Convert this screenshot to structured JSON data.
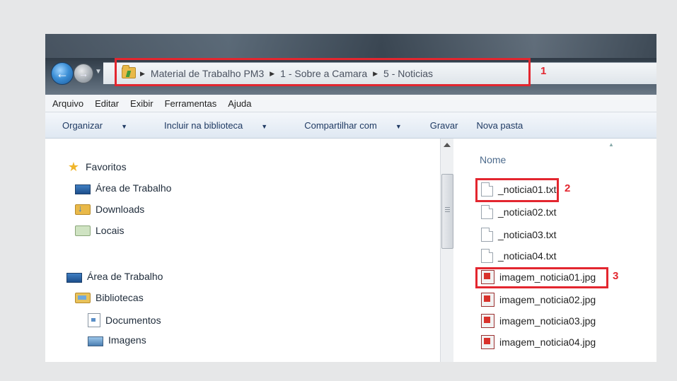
{
  "address_bar": {
    "crumbs": [
      "Material de Trabalho PM3",
      "1 - Sobre a Camara",
      "5 - Noticias"
    ],
    "marker": "1"
  },
  "menu": [
    "Arquivo",
    "Editar",
    "Exibir",
    "Ferramentas",
    "Ajuda"
  ],
  "toolbar": {
    "organize": "Organizar",
    "include_library": "Incluir na biblioteca",
    "share": "Compartilhar com",
    "burn": "Gravar",
    "new_folder": "Nova pasta"
  },
  "nav": {
    "favorites": "Favoritos",
    "fav_desktop": "Área de Trabalho",
    "downloads": "Downloads",
    "locais": "Locais",
    "desktop": "Área de Trabalho",
    "libraries": "Bibliotecas",
    "documents": "Documentos",
    "images": "Imagens"
  },
  "file_list": {
    "column_name": "Nome",
    "files": [
      "_noticia01.txt",
      "_noticia02.txt",
      "_noticia03.txt",
      "_noticia04.txt",
      "imagem_noticia01.jpg",
      "imagem_noticia02.jpg",
      "imagem_noticia03.jpg",
      "imagem_noticia04.jpg"
    ],
    "marker_txt": "2",
    "marker_jpg": "3"
  },
  "colors": {
    "highlight": "#e3262f"
  }
}
